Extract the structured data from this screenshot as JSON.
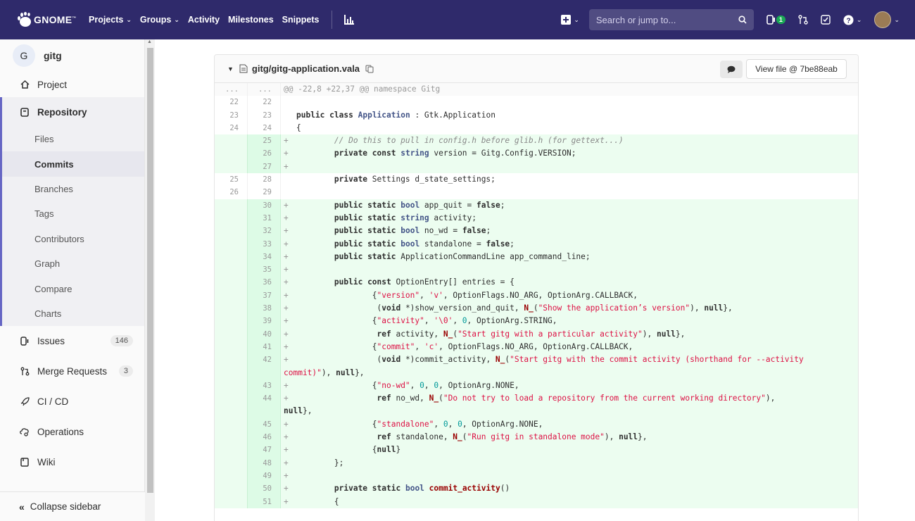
{
  "navbar": {
    "brand": "GNOME",
    "brand_mark": "™",
    "links": [
      {
        "label": "Projects",
        "dropdown": true
      },
      {
        "label": "Groups",
        "dropdown": true
      },
      {
        "label": "Activity",
        "dropdown": false
      },
      {
        "label": "Milestones",
        "dropdown": false
      },
      {
        "label": "Snippets",
        "dropdown": false
      }
    ],
    "search_placeholder": "Search or jump to...",
    "issues_count": "1",
    "bg_color": "#2f2a6b"
  },
  "sidebar": {
    "project_initial": "G",
    "project_name": "gitg",
    "project_label": "Project",
    "repository_label": "Repository",
    "repository_items": [
      "Files",
      "Commits",
      "Branches",
      "Tags",
      "Contributors",
      "Graph",
      "Compare",
      "Charts"
    ],
    "active_item": "Commits",
    "issues_label": "Issues",
    "issues_count": "146",
    "mr_label": "Merge Requests",
    "mr_count": "3",
    "cicd_label": "CI / CD",
    "operations_label": "Operations",
    "wiki_label": "Wiki",
    "collapse_label": "Collapse sidebar"
  },
  "file": {
    "path": "gitg/gitg-application.vala",
    "view_button": "View file @ 7be88eab"
  },
  "diff_lines": [
    {
      "type": "match",
      "old": "...",
      "new": "...",
      "html": "@@ -22,8 +22,37 @@ namespace Gitg"
    },
    {
      "type": "ctx",
      "old": "22",
      "new": "22",
      "html": ""
    },
    {
      "type": "ctx",
      "old": "23",
      "new": "23",
      "html": "<span class=\"kw\">public</span> <span class=\"kw\">class</span> <span class=\"cls\">Application</span> : Gtk.Application"
    },
    {
      "type": "ctx",
      "old": "24",
      "new": "24",
      "html": "{"
    },
    {
      "type": "add",
      "old": "",
      "new": "25",
      "html": "        <span class=\"cm\">// Do this to pull in config.h before glib.h (for gettext...)</span>"
    },
    {
      "type": "add",
      "old": "",
      "new": "26",
      "html": "        <span class=\"kw\">private</span> <span class=\"kw\">const</span> <span class=\"ty\">string</span> version = Gitg.Config.VERSION;"
    },
    {
      "type": "add",
      "old": "",
      "new": "27",
      "html": ""
    },
    {
      "type": "ctx",
      "old": "25",
      "new": "28",
      "html": "        <span class=\"kw\">private</span> Settings d_state_settings;"
    },
    {
      "type": "ctx",
      "old": "26",
      "new": "29",
      "html": ""
    },
    {
      "type": "add",
      "old": "",
      "new": "30",
      "html": "        <span class=\"kw\">public</span> <span class=\"kw\">static</span> <span class=\"ty\">bool</span> app_quit = <span class=\"kw\">false</span>;"
    },
    {
      "type": "add",
      "old": "",
      "new": "31",
      "html": "        <span class=\"kw\">public</span> <span class=\"kw\">static</span> <span class=\"ty\">string</span> activity;"
    },
    {
      "type": "add",
      "old": "",
      "new": "32",
      "html": "        <span class=\"kw\">public</span> <span class=\"kw\">static</span> <span class=\"ty\">bool</span> no_wd = <span class=\"kw\">false</span>;"
    },
    {
      "type": "add",
      "old": "",
      "new": "33",
      "html": "        <span class=\"kw\">public</span> <span class=\"kw\">static</span> <span class=\"ty\">bool</span> standalone = <span class=\"kw\">false</span>;"
    },
    {
      "type": "add",
      "old": "",
      "new": "34",
      "html": "        <span class=\"kw\">public</span> <span class=\"kw\">static</span> ApplicationCommandLine app_command_line;"
    },
    {
      "type": "add",
      "old": "",
      "new": "35",
      "html": ""
    },
    {
      "type": "add",
      "old": "",
      "new": "36",
      "html": "        <span class=\"kw\">public</span> <span class=\"kw\">const</span> OptionEntry[] entries = {"
    },
    {
      "type": "add",
      "old": "",
      "new": "37",
      "html": "                {<span class=\"str\">\"version\"</span>, <span class=\"str\">'v'</span>, OptionFlags.NO_ARG, OptionArg.CALLBACK,"
    },
    {
      "type": "add",
      "old": "",
      "new": "38",
      "html": "                 (<span class=\"kw\">void</span> *)show_version_and_quit, <span class=\"fn\">N_</span>(<span class=\"str\">\"Show the application’s version\"</span>), <span class=\"kw\">null</span>},"
    },
    {
      "type": "add",
      "old": "",
      "new": "39",
      "html": "                {<span class=\"str\">\"activity\"</span>, <span class=\"str\">'\\0'</span>, <span class=\"num\">0</span>, OptionArg.STRING,"
    },
    {
      "type": "add",
      "old": "",
      "new": "40",
      "html": "                 <span class=\"kw\">ref</span> activity, <span class=\"fn\">N_</span>(<span class=\"str\">\"Start gitg with a particular activity\"</span>), <span class=\"kw\">null</span>},"
    },
    {
      "type": "add",
      "old": "",
      "new": "41",
      "html": "                {<span class=\"str\">\"commit\"</span>, <span class=\"str\">'c'</span>, OptionFlags.NO_ARG, OptionArg.CALLBACK,"
    },
    {
      "type": "add",
      "old": "",
      "new": "42",
      "html": "                 (<span class=\"kw\">void</span> *)commit_activity, <span class=\"fn\">N_</span>(<span class=\"str\">\"Start gitg with the commit activity (shorthand for --activity\ncommit)\"</span>), <span class=\"kw\">null</span>},"
    },
    {
      "type": "add",
      "old": "",
      "new": "43",
      "html": "                {<span class=\"str\">\"no-wd\"</span>, <span class=\"num\">0</span>, <span class=\"num\">0</span>, OptionArg.NONE,"
    },
    {
      "type": "add",
      "old": "",
      "new": "44",
      "html": "                 <span class=\"kw\">ref</span> no_wd, <span class=\"fn\">N_</span>(<span class=\"str\">\"Do not try to load a repository from the current working directory\"</span>),\n<span class=\"kw\">null</span>},"
    },
    {
      "type": "add",
      "old": "",
      "new": "45",
      "html": "                {<span class=\"str\">\"standalone\"</span>, <span class=\"num\">0</span>, <span class=\"num\">0</span>, OptionArg.NONE,"
    },
    {
      "type": "add",
      "old": "",
      "new": "46",
      "html": "                 <span class=\"kw\">ref</span> standalone, <span class=\"fn\">N_</span>(<span class=\"str\">\"Run gitg in standalone mode\"</span>), <span class=\"kw\">null</span>},"
    },
    {
      "type": "add",
      "old": "",
      "new": "47",
      "html": "                {<span class=\"kw\">null</span>}"
    },
    {
      "type": "add",
      "old": "",
      "new": "48",
      "html": "        };"
    },
    {
      "type": "add",
      "old": "",
      "new": "49",
      "html": ""
    },
    {
      "type": "add",
      "old": "",
      "new": "50",
      "html": "        <span class=\"kw\">private</span> <span class=\"kw\">static</span> <span class=\"ty\">bool</span> <span class=\"fn\">commit_activity</span>()"
    },
    {
      "type": "add",
      "old": "",
      "new": "51",
      "html": "        {"
    }
  ]
}
